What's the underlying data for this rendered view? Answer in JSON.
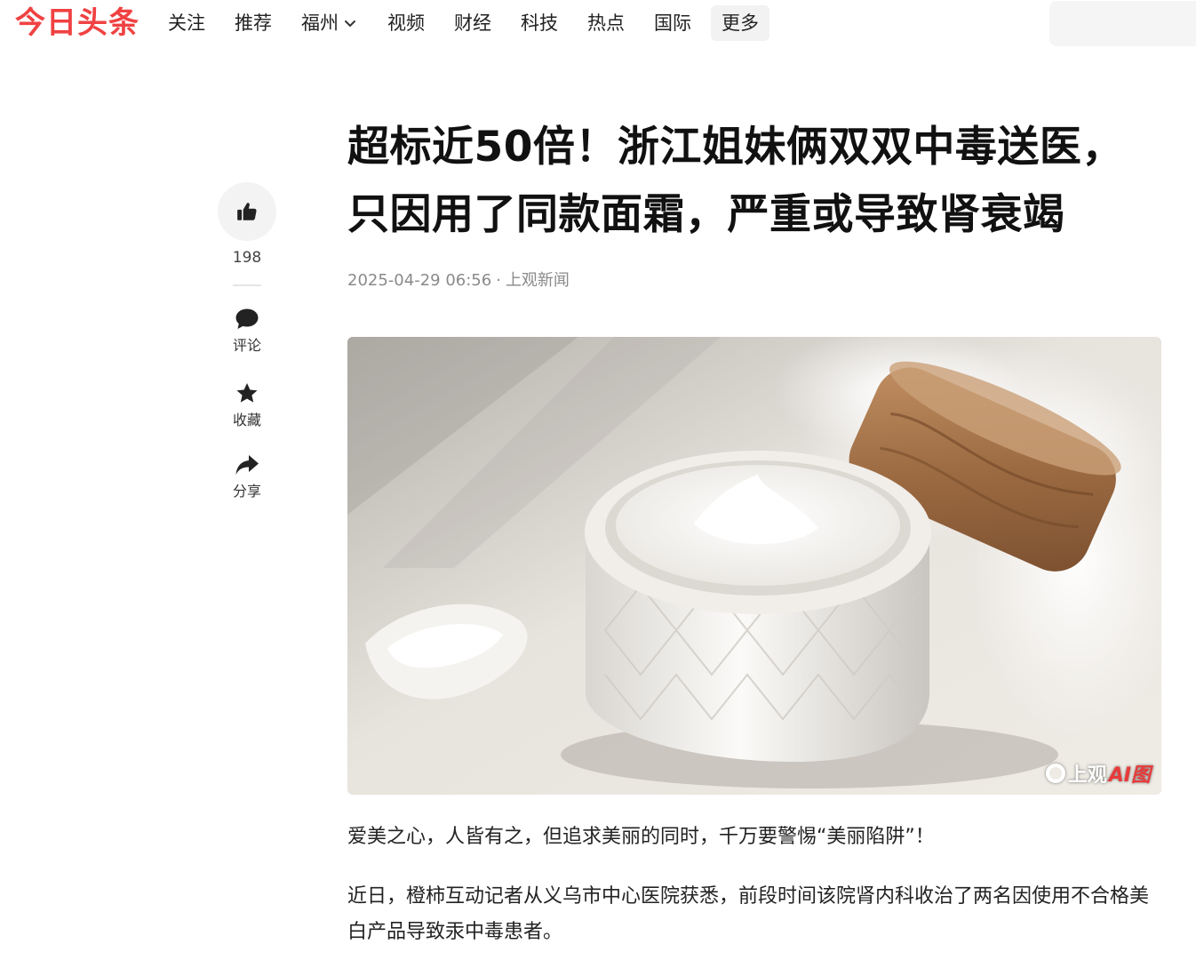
{
  "app": {
    "logo": "今日头条"
  },
  "nav": {
    "items": [
      {
        "label": "关注"
      },
      {
        "label": "推荐"
      },
      {
        "label": "福州"
      },
      {
        "label": "视频"
      },
      {
        "label": "财经"
      },
      {
        "label": "科技"
      },
      {
        "label": "热点"
      },
      {
        "label": "国际"
      },
      {
        "label": "更多"
      }
    ]
  },
  "actions": {
    "like_count": "198",
    "comment_label": "评论",
    "favorite_label": "收藏",
    "share_label": "分享",
    "icons": [
      "thumbs-up-icon",
      "comment-icon",
      "star-icon",
      "share-icon"
    ]
  },
  "article": {
    "title_line1": "超标近50倍！浙江姐妹俩双双中毒送医，",
    "title_line2": "只因用了同款面霜，严重或导致肾衰竭",
    "date": "2025-04-29 06:56",
    "separator": "·",
    "source": "上观新闻",
    "image_watermark_text": "上观",
    "image_watermark_ai": "AI图",
    "paragraphs": [
      "爱美之心，人皆有之，但追求美丽的同时，千万要警惕“美丽陷阱”！",
      "近日，橙柿互动记者从义乌市中心医院获悉，前段时间该院肾内科收治了两名因使用不合格美白产品导致汞中毒患者。"
    ]
  },
  "colors": {
    "brand_red": "#f04142",
    "text": "#222222",
    "meta": "#8a8a8a"
  }
}
